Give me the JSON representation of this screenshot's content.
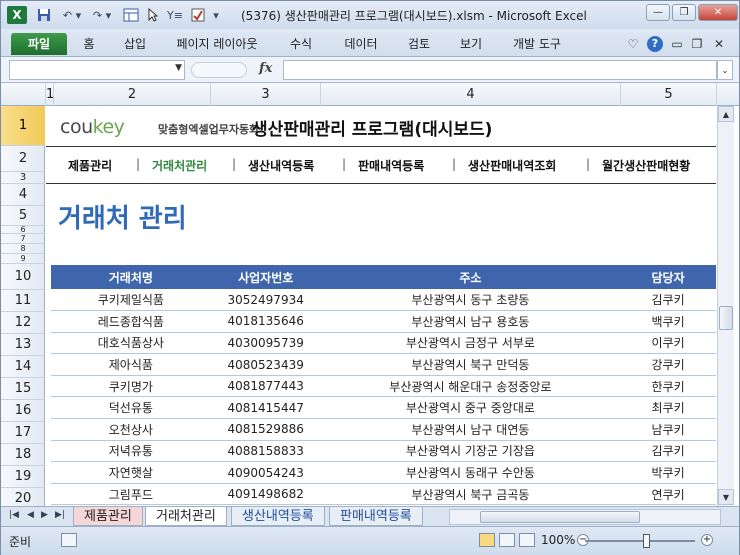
{
  "window": {
    "title": "(5376) 생산판매관리 프로그램(대시보드).xlsm  -  Microsoft Excel",
    "app_icon_label": "X"
  },
  "ribbon": {
    "tabs": [
      "파일",
      "홈",
      "삽입",
      "페이지 레이아웃",
      "수식",
      "데이터",
      "검토",
      "보기",
      "개발 도구"
    ],
    "help_label": "?"
  },
  "formula_bar": {
    "name_box": "",
    "fx_label": "fx",
    "formula": ""
  },
  "columns": [
    "1",
    "2",
    "3",
    "4",
    "5"
  ],
  "rows": [
    "1",
    "2",
    "3",
    "4",
    "5",
    "6",
    "7",
    "8",
    "9",
    "10",
    "11",
    "12",
    "13",
    "14",
    "15",
    "16",
    "17",
    "18",
    "19",
    "20"
  ],
  "sheet": {
    "brand_part1": "cou",
    "brand_part2": "key",
    "brand_tagline": "맞춤형엑셀업무자동화",
    "app_title": "생산판매관리 프로그램(대시보드)",
    "menu": [
      "제품관리",
      "거래처관리",
      "생산내역등록",
      "판매내역등록",
      "생산판매내역조회",
      "월간생산판매현황"
    ],
    "menu_separator": "|",
    "heading": "거래처 관리",
    "table": {
      "headers": [
        "거래처명",
        "사업자번호",
        "주소",
        "담당자"
      ],
      "rows": [
        [
          "쿠키제일식품",
          "3052497934",
          "부산광역시 동구 초량동",
          "김쿠키"
        ],
        [
          "레드종합식품",
          "4018135646",
          "부산광역시 남구 용호동",
          "백쿠키"
        ],
        [
          "대호식품상사",
          "4030095739",
          "부산광역시 금정구 서부로",
          "이쿠키"
        ],
        [
          "제아식품",
          "4080523439",
          "부산광역시 북구 만덕동",
          "강쿠키"
        ],
        [
          "쿠키명가",
          "4081877443",
          "부산광역시 해운대구 송정중앙로",
          "한쿠키"
        ],
        [
          "덕선유통",
          "4081415447",
          "부산광역시 중구 중앙대로",
          "최쿠키"
        ],
        [
          "오천상사",
          "4081529886",
          "부산광역시 남구 대연동",
          "남쿠키"
        ],
        [
          "저녁유통",
          "4088158833",
          "부산광역시 기장군 기장읍",
          "김쿠키"
        ],
        [
          "자연햇살",
          "4090054243",
          "부산광역시 동래구 수안동",
          "박쿠키"
        ],
        [
          "그림푸드",
          "4091498682",
          "부산광역시 북구 금곡동",
          "연쿠키"
        ]
      ]
    }
  },
  "sheet_tabs": [
    "제품관리",
    "거래처관리",
    "생산내역등록",
    "판매내역등록"
  ],
  "status": {
    "ready": "준비",
    "zoom": "100%"
  }
}
